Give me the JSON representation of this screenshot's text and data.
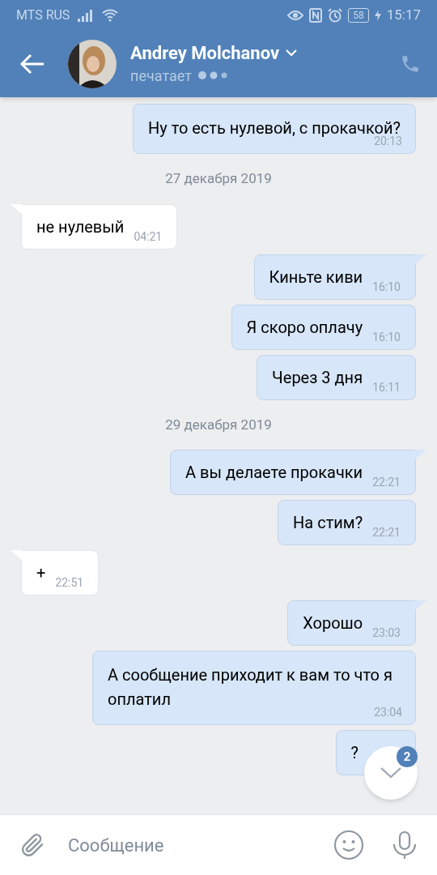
{
  "status_bar": {
    "carrier": "MTS RUS",
    "battery": "58",
    "time": "15:17"
  },
  "header": {
    "name": "Andrey Molchanov",
    "status": "печатает"
  },
  "messages": [
    {
      "kind": "outgoing",
      "tail": false,
      "text": "Ну то есть нулевой, с прокачкой?",
      "time": "20:13"
    },
    {
      "kind": "date",
      "text": "27 декабря 2019"
    },
    {
      "kind": "incoming",
      "tail": true,
      "text": "не нулевый",
      "time": "04:21"
    },
    {
      "kind": "outgoing",
      "tail": true,
      "text": "Киньте киви",
      "time": "16:10"
    },
    {
      "kind": "outgoing",
      "tail": false,
      "text": "Я скоро оплачу",
      "time": "16:10"
    },
    {
      "kind": "outgoing",
      "tail": false,
      "text": "Через 3 дня",
      "time": "16:11"
    },
    {
      "kind": "date",
      "text": "29 декабря 2019"
    },
    {
      "kind": "outgoing",
      "tail": true,
      "text": "А вы делаете прокачки",
      "time": "22:21"
    },
    {
      "kind": "outgoing",
      "tail": false,
      "text": "На стим?",
      "time": "22:21"
    },
    {
      "kind": "incoming",
      "tail": true,
      "text": "+",
      "time": "22:51"
    },
    {
      "kind": "outgoing",
      "tail": true,
      "text": "Хорошо",
      "time": "23:03"
    },
    {
      "kind": "outgoing",
      "tail": false,
      "text": "А сообщение приходит к вам то что я оплатил",
      "time": "23:04"
    },
    {
      "kind": "outgoing",
      "tail": false,
      "text": "?"
    }
  ],
  "scroll_button": {
    "badge": "2"
  },
  "composer": {
    "placeholder": "Сообщение"
  }
}
